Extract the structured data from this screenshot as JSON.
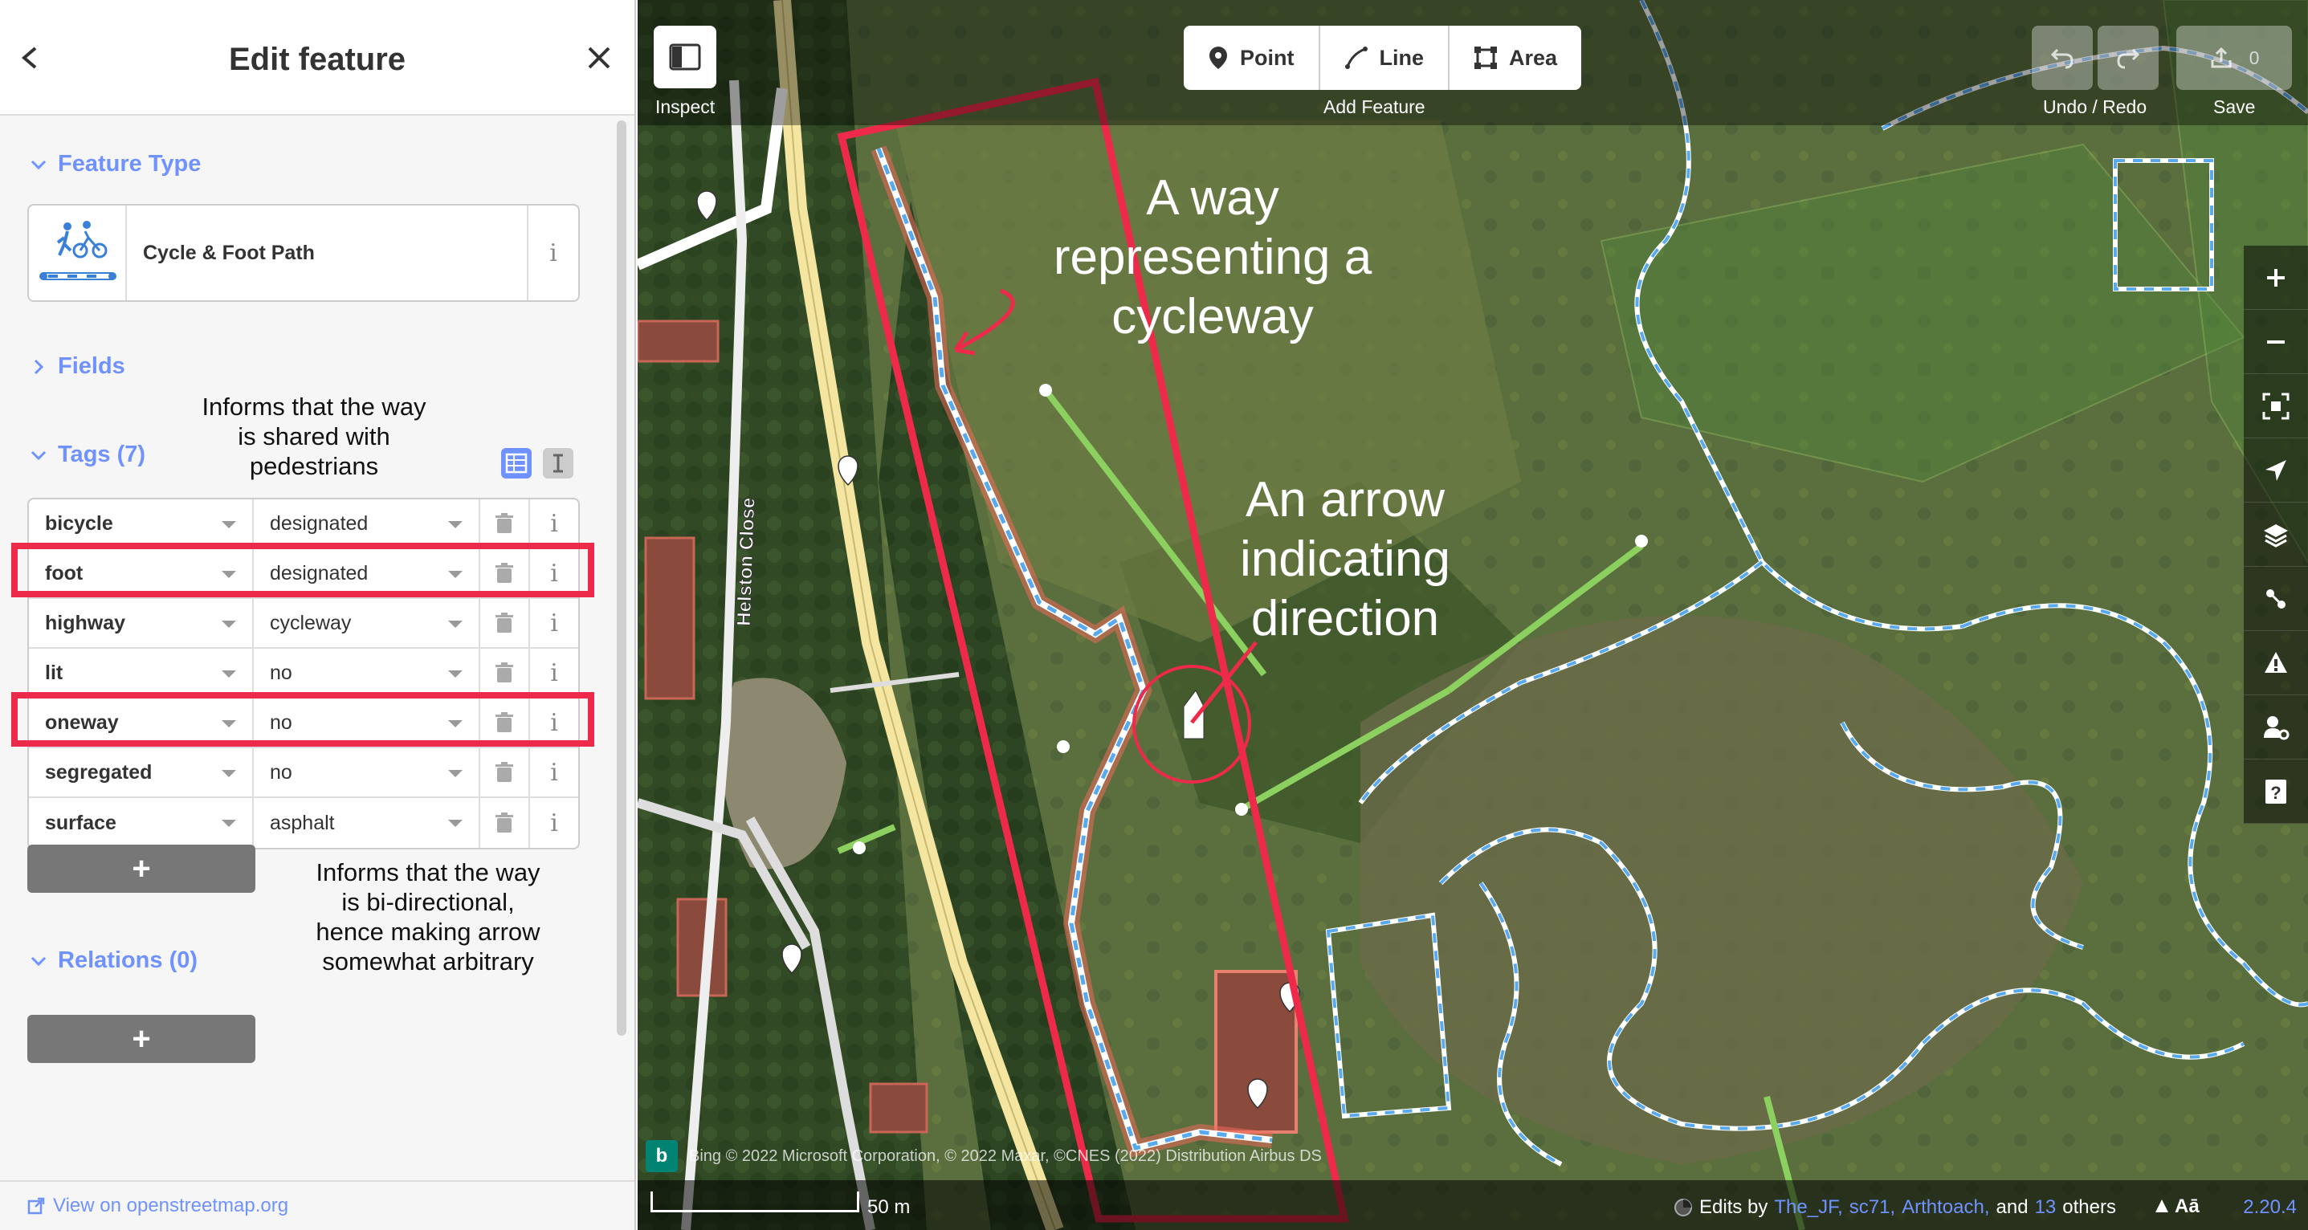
{
  "sidebar": {
    "title": "Edit feature",
    "feature_type_label": "Feature Type",
    "preset_name": "Cycle & Foot Path",
    "fields_label": "Fields",
    "tags_label": "Tags (7)",
    "relations_label": "Relations (0)",
    "tags": [
      {
        "key": "bicycle",
        "value": "designated"
      },
      {
        "key": "foot",
        "value": "designated"
      },
      {
        "key": "highway",
        "value": "cycleway"
      },
      {
        "key": "lit",
        "value": "no"
      },
      {
        "key": "oneway",
        "value": "no"
      },
      {
        "key": "segregated",
        "value": "no"
      },
      {
        "key": "surface",
        "value": "asphalt"
      }
    ],
    "add_tag_label": "+",
    "add_relation_label": "+",
    "footer_link": "View on openstreetmap.org",
    "info_glyph": "i"
  },
  "annotations": {
    "shared": "Informs that the way is shared with pedestrians",
    "bidirectional": "Informs that the way is bi-directional, hence making arrow somewhat arbitrary",
    "cycleway": "A way representing a cycleway",
    "arrow": "An arrow indicating direction"
  },
  "toolbar": {
    "inspect_label": "Inspect",
    "point_label": "Point",
    "line_label": "Line",
    "area_label": "Area",
    "add_feature_label": "Add Feature",
    "undo_redo_label": "Undo / Redo",
    "save_label": "Save",
    "save_count": "0"
  },
  "map": {
    "street_label": "Helston Close",
    "attribution": "Bing © 2022 Microsoft Corporation, © 2022 Maxar, ©CNES (2022) Distribution Airbus DS",
    "scale_label": "50 m",
    "edits_prefix": "Edits by",
    "editors": [
      "The_JF,",
      "sc71,",
      "Arthtoach,"
    ],
    "edits_and": "and",
    "edits_count": "13",
    "edits_others": "others",
    "version": "2.20.4"
  },
  "colors": {
    "accent": "#7092ff",
    "highlight": "#ee2a4a",
    "cycleway": "#58a9ed",
    "line_green": "#8cd05f"
  }
}
